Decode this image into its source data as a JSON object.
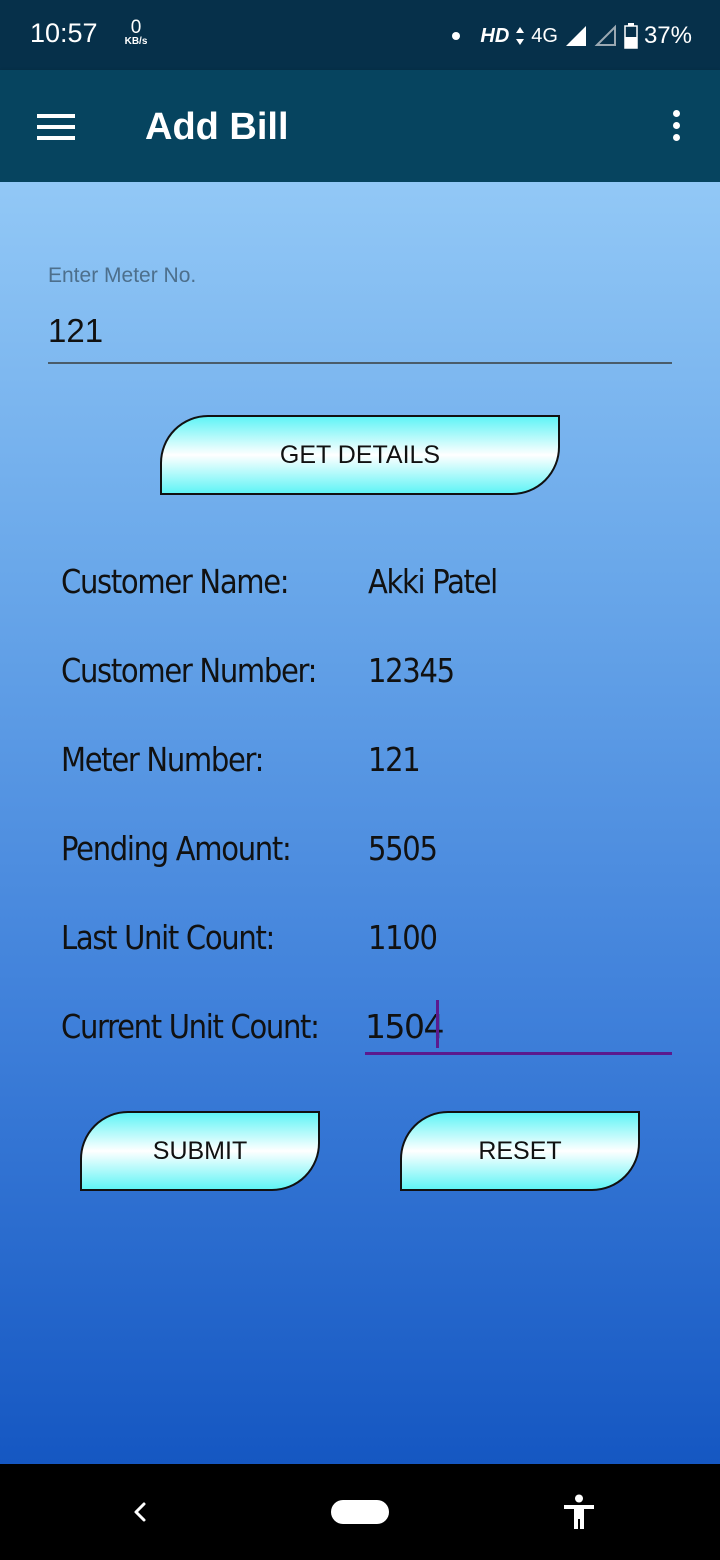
{
  "status_bar": {
    "time": "10:57",
    "data_speed_value": "0",
    "data_speed_unit": "KB/s",
    "hd_label": "HD",
    "network_label": "4G",
    "battery": "37%"
  },
  "app_bar": {
    "title": "Add Bill",
    "menu_icon": "hamburger-icon",
    "more_icon": "more-vertical-icon"
  },
  "form": {
    "meter_label": "Enter Meter No.",
    "meter_value": "121",
    "get_details_label": "GET DETAILS",
    "details": [
      {
        "label": "Customer Name:",
        "value": "Akki Patel"
      },
      {
        "label": "Customer Number:",
        "value": "12345"
      },
      {
        "label": "Meter Number:",
        "value": "121"
      },
      {
        "label": "Pending Amount:",
        "value": "5505"
      },
      {
        "label": "Last Unit Count:",
        "value": "1100"
      }
    ],
    "current_unit_label": "Current Unit Count:",
    "current_unit_value": "1504",
    "submit_label": "SUBMIT",
    "reset_label": "RESET"
  },
  "nav_bar": {
    "back_icon": "back-icon",
    "home_icon": "home-pill-icon",
    "accessibility_icon": "accessibility-icon"
  },
  "colors": {
    "app_bar": "#06445f",
    "status_bar": "#06304a",
    "button_cyan": "#60f4f6",
    "input_underline_active": "#5b1a8e"
  }
}
